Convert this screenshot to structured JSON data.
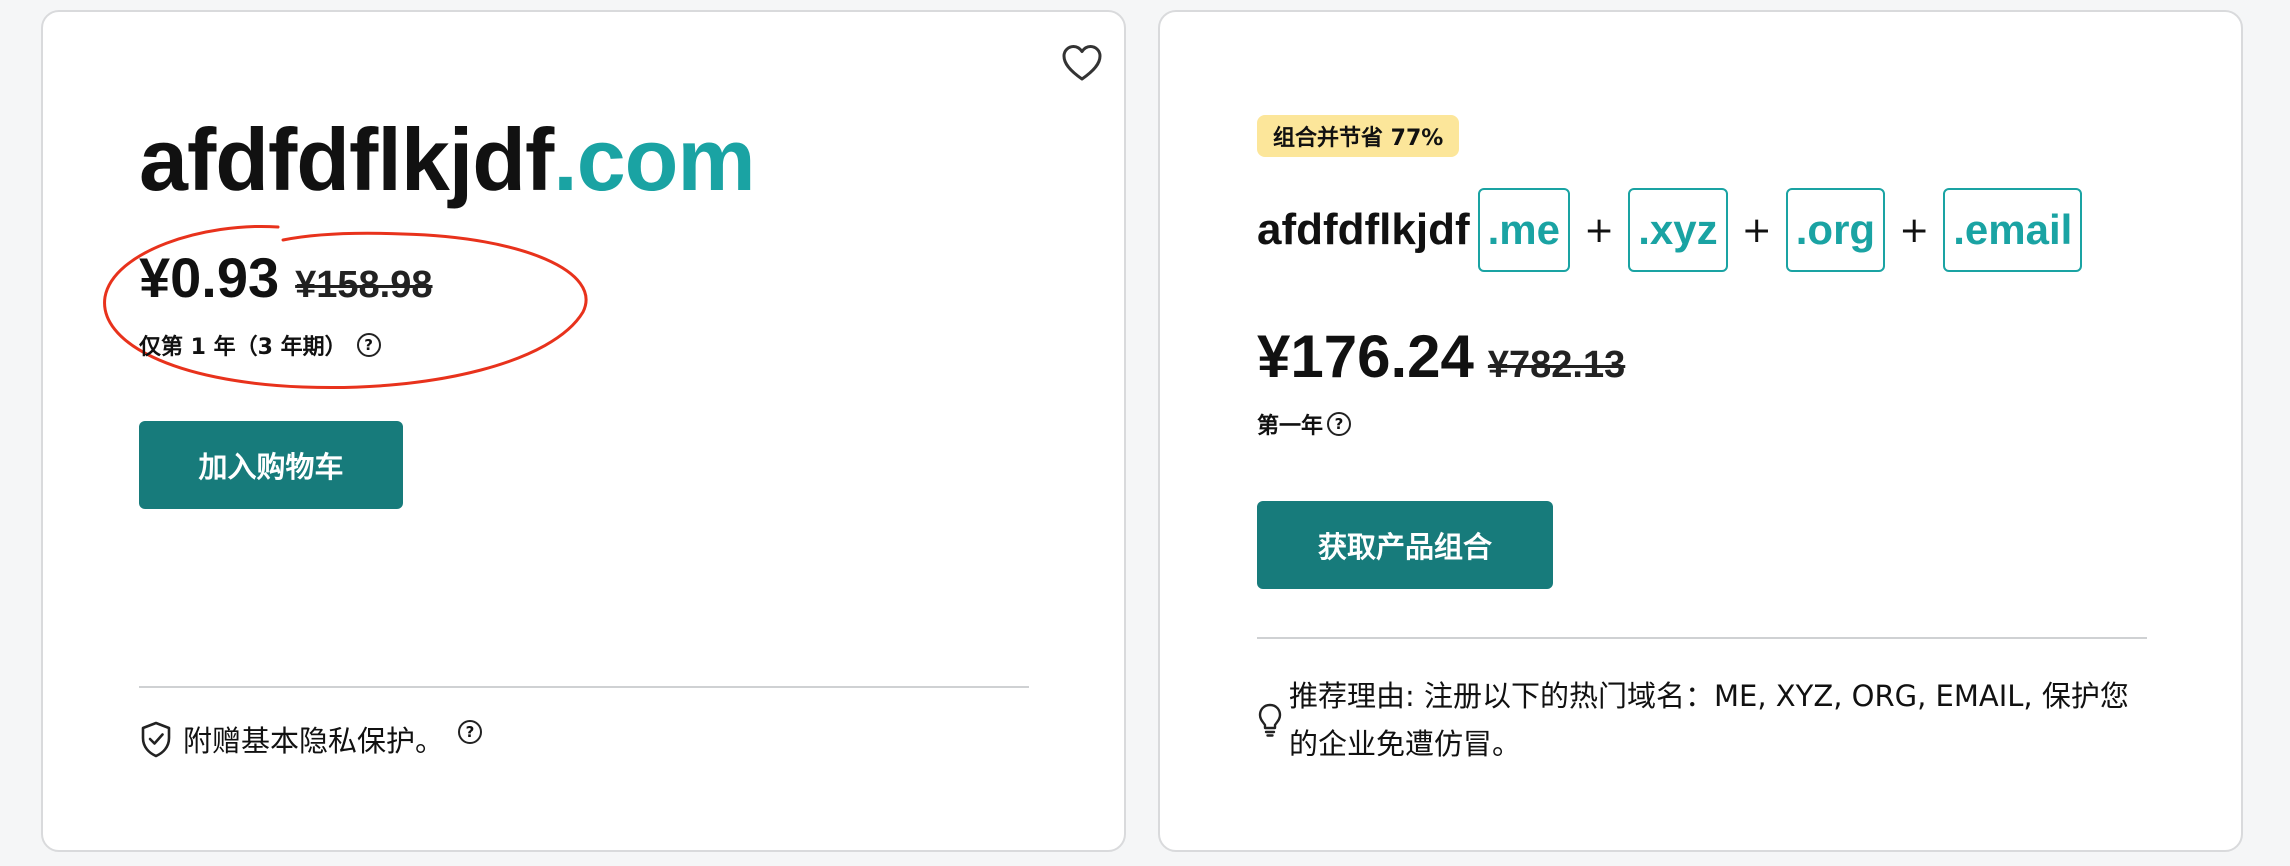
{
  "left_card": {
    "domain_name": "afdfdflkjdf",
    "domain_tld": ".com",
    "price_now": "¥0.93",
    "price_old": "¥158.98",
    "term": "仅第 1 年（3 年期）",
    "help_glyph": "?",
    "add_to_cart_label": "加入购物车",
    "privacy_text": "附赠基本隐私保护。",
    "favorite_icon": "heart-outline",
    "annotation_color": "#e8321c"
  },
  "right_card": {
    "save_badge": "组合并节省 77%",
    "bundle_name": "afdfdflkjdf",
    "tlds": [
      ".me",
      ".xyz",
      ".org",
      ".email"
    ],
    "plus": "+",
    "price_now": "¥176.24",
    "price_old": "¥782.13",
    "first_year": "第一年",
    "help_glyph": "?",
    "get_bundle_label": "获取产品组合",
    "reason_text": "推荐理由: 注册以下的热门域名：ME, XYZ, ORG, EMAIL, 保护您的企业免遭仿冒。"
  },
  "colors": {
    "accent": "#1aa3a3",
    "button": "#177b7b",
    "badge": "#fce69a"
  }
}
